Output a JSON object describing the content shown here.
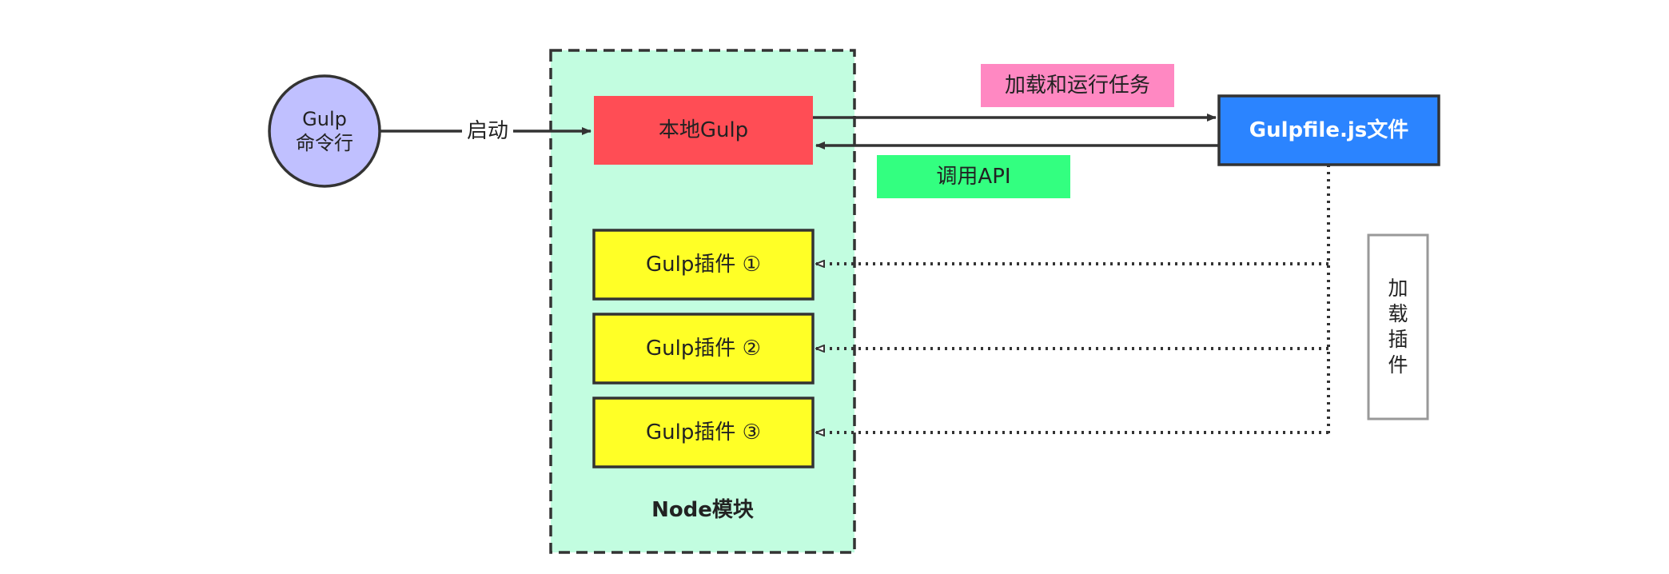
{
  "cli_node": {
    "label_line1": "Gulp",
    "label_line2": "命令行"
  },
  "launch_label": "启动",
  "node_module": {
    "title": "Node模块",
    "local_gulp": "本地Gulp",
    "plugins": [
      "Gulp插件 ①",
      "Gulp插件 ②",
      "Gulp插件 ③"
    ]
  },
  "gulpfile": {
    "label": "Gulpfile.js文件"
  },
  "load_run_tasks_label": "加载和运行任务",
  "call_api_label": "调用API",
  "load_plugins_label": "加\n载\n插\n件",
  "colors": {
    "cli_fill": "#c0c0ff",
    "module_fill": "#c2fde0",
    "local_gulp_fill": "#ff4d55",
    "plugin_fill": "#ffff26",
    "gulpfile_fill": "#2b84ff",
    "tasks_label_fill": "#ff88c2",
    "api_label_fill": "#33ff80",
    "stroke": "#333333"
  }
}
